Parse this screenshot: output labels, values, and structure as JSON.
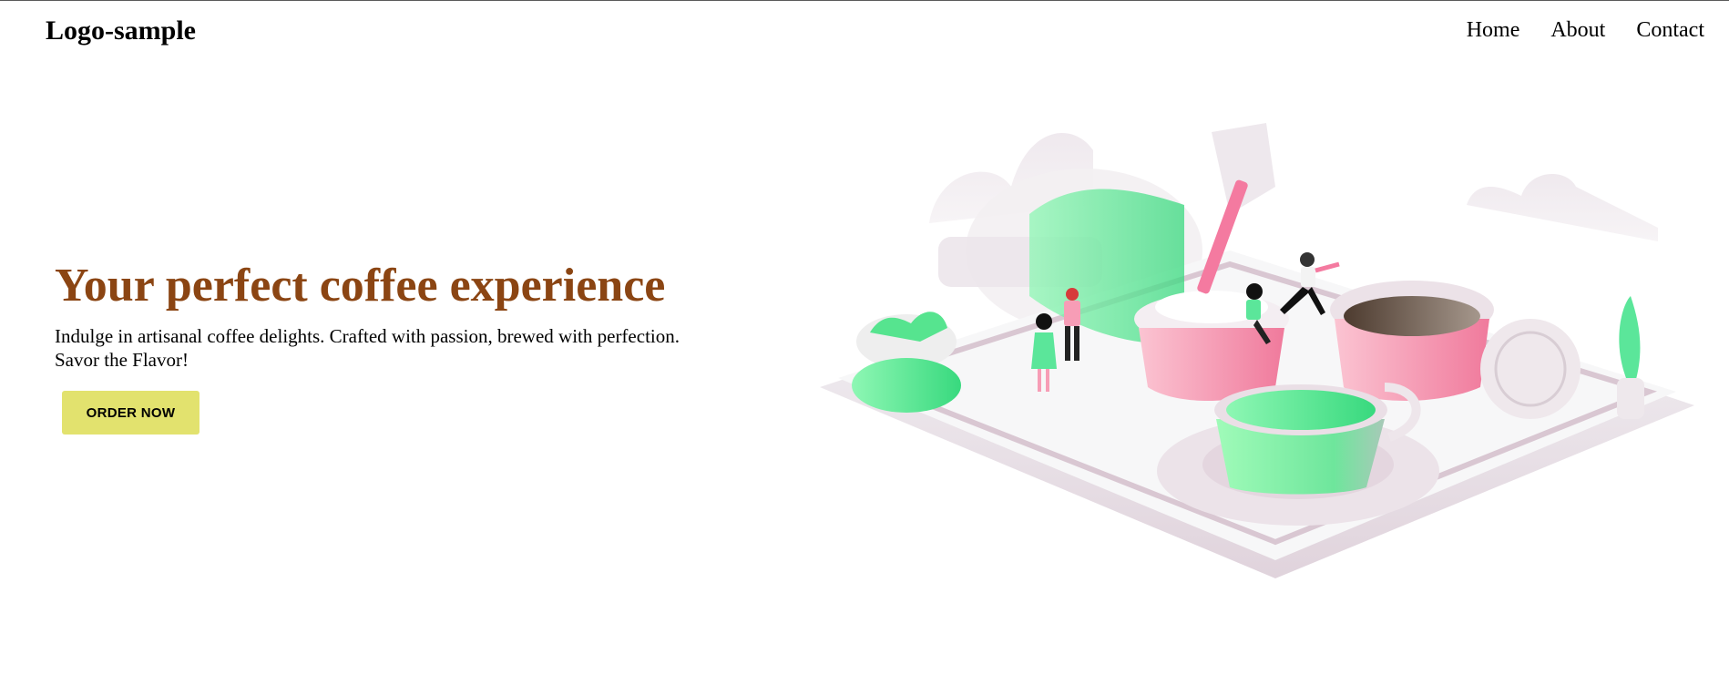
{
  "header": {
    "logo": "Logo-sample",
    "nav": [
      {
        "label": "Home"
      },
      {
        "label": "About"
      },
      {
        "label": "Contact"
      }
    ]
  },
  "hero": {
    "title": "Your perfect coffee experience",
    "subtitle_line1": "Indulge in artisanal coffee delights. Crafted with passion, brewed with perfection.",
    "subtitle_line2": "Savor the Flavor!",
    "cta_label": "ORDER NOW"
  },
  "colors": {
    "title": "#8b4513",
    "cta_background": "#e2e26e",
    "accent_green": "#3ee08a",
    "accent_pink": "#f47aa0"
  },
  "illustration": {
    "description_icon": "coffee-tray-illustration"
  }
}
